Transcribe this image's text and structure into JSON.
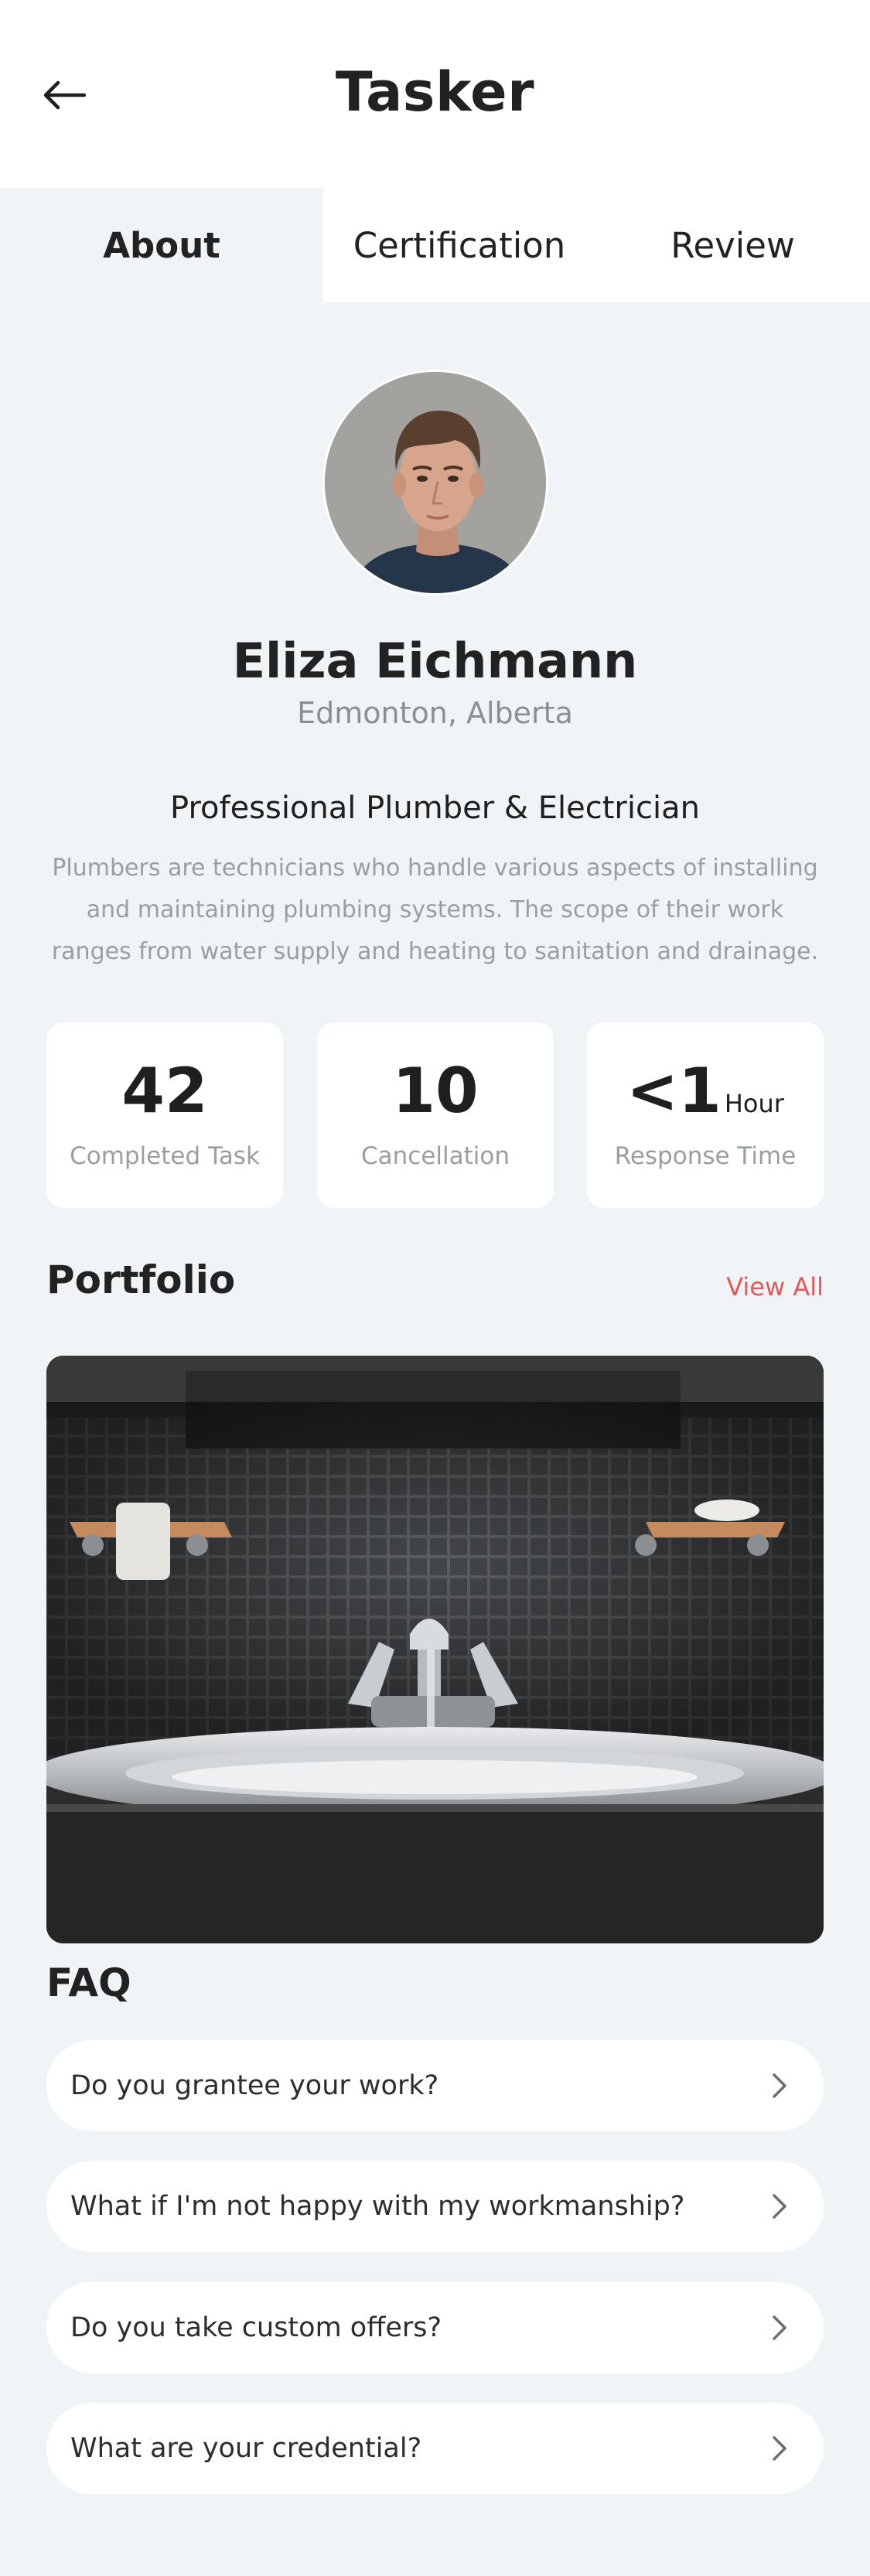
{
  "header": {
    "title": "Tasker",
    "back_icon": "arrow-left-icon"
  },
  "tabs": [
    {
      "label": "About",
      "active": true
    },
    {
      "label": "Certification",
      "active": false
    },
    {
      "label": "Review",
      "active": false
    }
  ],
  "profile": {
    "name": "Eliza Eichmann",
    "location": "Edmonton, Alberta",
    "profession": "Professional Plumber & Electrician",
    "bio": "Plumbers are technicians who handle various aspects of installing and maintaining plumbing systems. The scope of their work ranges from water supply and heating to sanitation and drainage."
  },
  "stats": [
    {
      "value": "42",
      "unit": "",
      "label": "Completed Task"
    },
    {
      "value": "10",
      "unit": "",
      "label": "Cancellation"
    },
    {
      "value": "<1",
      "unit": "Hour",
      "label": "Response Time"
    }
  ],
  "portfolio": {
    "title": "Portfolio",
    "view_all": "View All"
  },
  "faq": {
    "title": "FAQ",
    "items": [
      {
        "question": "Do you grantee your work?"
      },
      {
        "question": "What if I'm not happy with my workmanship?"
      },
      {
        "question": "Do you take custom offers?"
      },
      {
        "question": "What are your credential?"
      }
    ]
  },
  "colors": {
    "background": "#f1f4f7",
    "card": "#ffffff",
    "accent": "#e05a5a",
    "muted_text": "#9a9ea3"
  }
}
